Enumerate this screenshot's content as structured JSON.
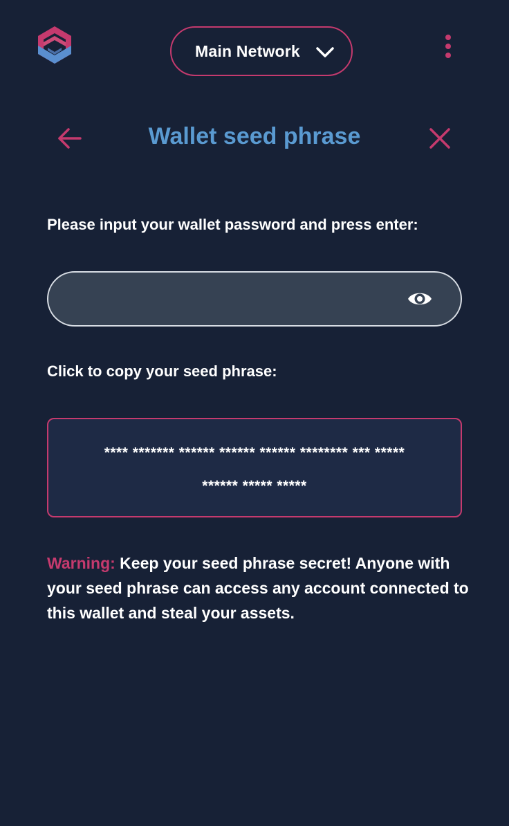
{
  "colors": {
    "background": "#172136",
    "accent": "#c53a6e",
    "title": "#5a9ad1",
    "input_bg": "#364253",
    "seed_bg": "#1e2a45"
  },
  "header": {
    "logo_icon": "hexagon-logo-icon",
    "network": {
      "label": "Main Network",
      "icon": "chevron-down-icon"
    },
    "menu_icon": "kebab-menu-icon"
  },
  "page": {
    "title": "Wallet seed phrase",
    "back_icon": "arrow-left-icon",
    "close_icon": "close-icon"
  },
  "form": {
    "password_prompt": "Please input your wallet password and press enter:",
    "password_value": "",
    "password_placeholder": "",
    "eye_icon": "eye-icon",
    "copy_prompt": "Click to copy your seed phrase:",
    "seed_phrase_masked": "**** ******* ****** ****** ****** ******** *** ***** ****** ***** *****"
  },
  "warning": {
    "label": "Warning:",
    "text": " Keep your seed phrase secret! Anyone with your seed phrase can access any account connected to this wallet and steal your assets."
  }
}
